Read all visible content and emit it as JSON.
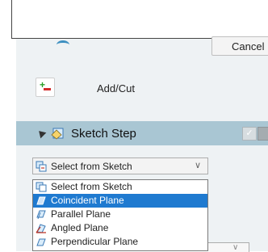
{
  "dialog": {
    "cancel_label": "Cancel"
  },
  "add_cut": {
    "label": "Add/Cut",
    "icon": "add-cut-icon"
  },
  "sketch_step": {
    "title": "Sketch Step",
    "icon": "sketch-icon",
    "header_color": "#a9c6d3"
  },
  "plane_select": {
    "selected": "Select from Sketch",
    "options": [
      {
        "label": "Select from Sketch"
      },
      {
        "label": "Coincident Plane"
      },
      {
        "label": "Parallel Plane"
      },
      {
        "label": "Angled Plane"
      },
      {
        "label": "Perpendicular Plane"
      }
    ],
    "highlighted_index": 1,
    "highlight_color": "#1f7ad0"
  }
}
